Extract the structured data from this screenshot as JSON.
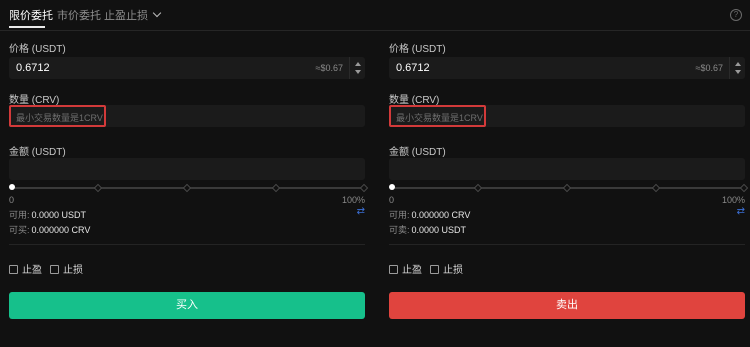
{
  "tabs": {
    "limit": "限价委托",
    "market": "市价委托",
    "stop": "止盈止损"
  },
  "colors": {
    "buy": "#16c08b",
    "sell": "#e0443e",
    "highlight": "#d23a3a",
    "swap_icon": "#3b6fd6"
  },
  "icons": {
    "help": "question-circle-icon",
    "dropdown": "chevron-down-icon",
    "swap": "swap-arrows-icon"
  },
  "buy": {
    "price_label": "价格 (USDT)",
    "price_value": "0.6712",
    "price_approx": "≈$0.67",
    "qty_label": "数量 (CRV)",
    "qty_placeholder": "最小交易数量是1CRV",
    "amount_label": "金额 (USDT)",
    "slider_min": "0",
    "slider_max": "100%",
    "slider_value": 0,
    "available_label": "可用:",
    "available_value": "0.0000 USDT",
    "buyable_label": "可买:",
    "buyable_value": "0.000000 CRV",
    "take_profit": "止盈",
    "stop_loss": "止损",
    "button": "买入"
  },
  "sell": {
    "price_label": "价格 (USDT)",
    "price_value": "0.6712",
    "price_approx": "≈$0.67",
    "qty_label": "数量 (CRV)",
    "qty_placeholder": "最小交易数量是1CRV",
    "amount_label": "金额 (USDT)",
    "slider_min": "0",
    "slider_max": "100%",
    "slider_value": 0,
    "available_label": "可用:",
    "available_value": "0.000000 CRV",
    "sellable_label": "可卖:",
    "sellable_value": "0.0000 USDT",
    "take_profit": "止盈",
    "stop_loss": "止损",
    "button": "卖出"
  }
}
